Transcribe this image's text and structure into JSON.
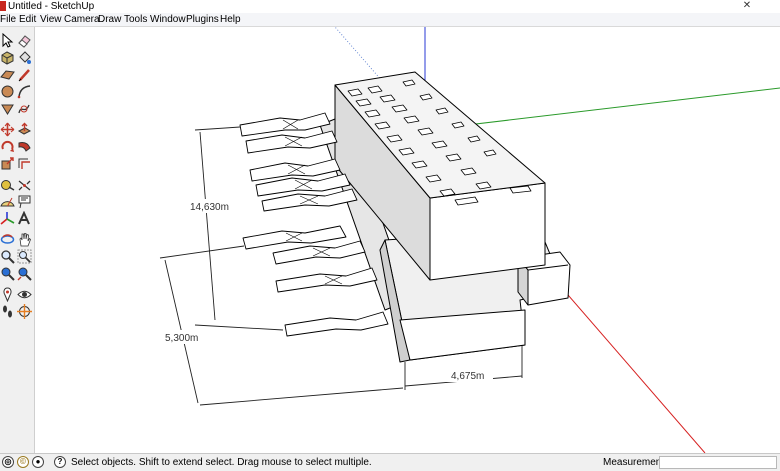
{
  "window": {
    "title": "Untitled - SketchUp",
    "control_glyph": "✕"
  },
  "menu": [
    "File",
    "Edit",
    "View",
    "Camera",
    "Draw",
    "Tools",
    "Window",
    "Plugins",
    "Help"
  ],
  "tools": [
    {
      "name": "select-tool",
      "icon": "select-arrow-icon"
    },
    {
      "name": "eraser-tool",
      "icon": "eraser-icon"
    },
    {
      "name": "component-tool",
      "icon": "component-icon"
    },
    {
      "name": "paint-bucket-tool",
      "icon": "paint-bucket-icon"
    },
    {
      "name": "rectangle-tool",
      "icon": "rectangle-icon"
    },
    {
      "name": "line-tool",
      "icon": "pencil-icon"
    },
    {
      "name": "circle-tool",
      "icon": "circle-icon"
    },
    {
      "name": "arc-tool",
      "icon": "arc-icon"
    },
    {
      "name": "polygon-tool",
      "icon": "polygon-icon"
    },
    {
      "name": "freehand-tool",
      "icon": "freehand-icon"
    },
    {
      "name": "move-tool",
      "icon": "move-icon"
    },
    {
      "name": "push-pull-tool",
      "icon": "push-pull-icon"
    },
    {
      "name": "rotate-tool",
      "icon": "rotate-icon"
    },
    {
      "name": "follow-me-tool",
      "icon": "follow-me-icon"
    },
    {
      "name": "scale-tool",
      "icon": "scale-icon"
    },
    {
      "name": "offset-tool",
      "icon": "offset-icon"
    },
    {
      "name": "tape-measure-tool",
      "icon": "tape-measure-icon"
    },
    {
      "name": "dimension-tool",
      "icon": "dimension-icon"
    },
    {
      "name": "protractor-tool",
      "icon": "protractor-icon"
    },
    {
      "name": "text-tool",
      "icon": "text-icon"
    },
    {
      "name": "axes-tool",
      "icon": "axes-icon"
    },
    {
      "name": "3d-text-tool",
      "icon": "3d-text-icon"
    },
    {
      "name": "orbit-tool",
      "icon": "orbit-icon"
    },
    {
      "name": "pan-tool",
      "icon": "pan-hand-icon"
    },
    {
      "name": "zoom-tool",
      "icon": "zoom-icon"
    },
    {
      "name": "zoom-window-tool",
      "icon": "zoom-window-icon"
    },
    {
      "name": "previous-view-tool",
      "icon": "previous-view-icon"
    },
    {
      "name": "zoom-extents-tool",
      "icon": "zoom-extents-icon"
    },
    {
      "name": "position-camera-tool",
      "icon": "position-camera-icon"
    },
    {
      "name": "look-around-tool",
      "icon": "eye-icon"
    },
    {
      "name": "walk-tool",
      "icon": "footprints-icon"
    },
    {
      "name": "section-plane-tool",
      "icon": "section-plane-icon"
    }
  ],
  "model": {
    "dimensions": {
      "depth": "14,630m",
      "height": "5,300m",
      "width": "4,675m"
    },
    "axes": {
      "red": "#d62020",
      "green": "#2a9a2a",
      "blue": "#2a3ad4"
    }
  },
  "status": {
    "hint": "Select objects. Shift to extend select. Drag mouse to select multiple.",
    "measurements_label": "Measurements",
    "measurements_value": "",
    "icons": [
      "geo-location-icon",
      "credits-icon",
      "user-icon",
      "help-icon"
    ]
  }
}
